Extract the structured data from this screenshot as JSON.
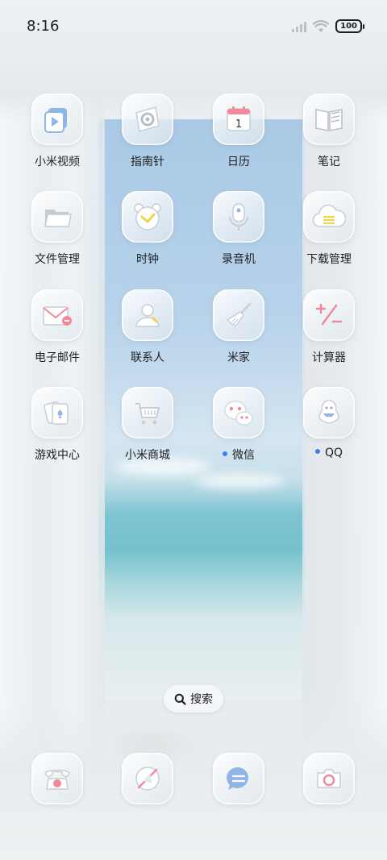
{
  "status_bar": {
    "time": "8:16",
    "battery": "100"
  },
  "apps": [
    {
      "label": "小米视频",
      "icon": "video-play-icon",
      "dot": false
    },
    {
      "label": "指南针",
      "icon": "compass-icon",
      "dot": false
    },
    {
      "label": "日历",
      "icon": "calendar-icon",
      "calendar_day": "1",
      "dot": false
    },
    {
      "label": "笔记",
      "icon": "notes-book-icon",
      "dot": false
    },
    {
      "label": "文件管理",
      "icon": "folder-icon",
      "dot": false
    },
    {
      "label": "时钟",
      "icon": "alarm-clock-icon",
      "dot": false
    },
    {
      "label": "录音机",
      "icon": "microphone-icon",
      "dot": false
    },
    {
      "label": "下载管理",
      "icon": "cloud-download-icon",
      "dot": false
    },
    {
      "label": "电子邮件",
      "icon": "mail-icon",
      "dot": false
    },
    {
      "label": "联系人",
      "icon": "contact-icon",
      "dot": false
    },
    {
      "label": "米家",
      "icon": "broom-icon",
      "dot": false
    },
    {
      "label": "计算器",
      "icon": "calculator-icon",
      "dot": false
    },
    {
      "label": "游戏中心",
      "icon": "playing-cards-icon",
      "dot": false
    },
    {
      "label": "小米商城",
      "icon": "shopping-cart-icon",
      "dot": false
    },
    {
      "label": "微信",
      "icon": "wechat-icon",
      "dot": true
    },
    {
      "label": "QQ",
      "icon": "qq-penguin-icon",
      "dot": true
    }
  ],
  "search": {
    "label": "搜索"
  },
  "dock": [
    {
      "icon": "phone-icon"
    },
    {
      "icon": "browser-compass-icon"
    },
    {
      "icon": "message-bubble-icon"
    },
    {
      "icon": "camera-icon"
    }
  ],
  "colors": {
    "accent_dot": "#3a7ef6",
    "icon_pink": "#f08a9b",
    "icon_blue": "#8fb6e6",
    "icon_yellow": "#f2d24a"
  }
}
